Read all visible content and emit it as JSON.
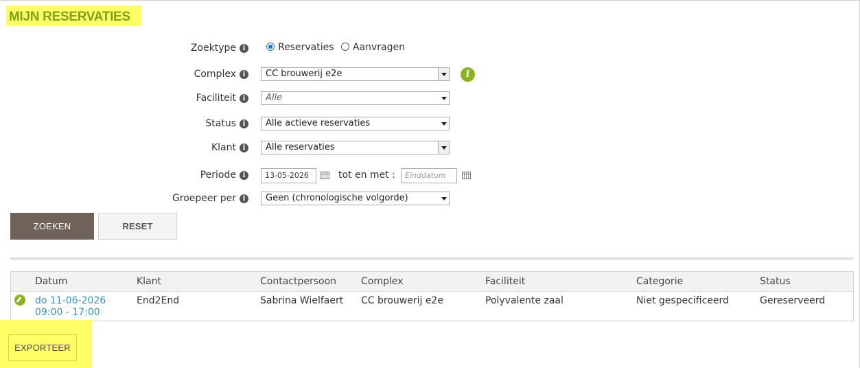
{
  "page": {
    "title": "MIJN RESERVATIES"
  },
  "form": {
    "zoektype": {
      "label": "Zoektype",
      "options": [
        "Reservaties",
        "Aanvragen"
      ],
      "selected": "Reservaties"
    },
    "complex": {
      "label": "Complex",
      "value": "CC brouwerij e2e"
    },
    "faciliteit": {
      "label": "Faciliteit",
      "value": "Alle"
    },
    "status": {
      "label": "Status",
      "value": "Alle actieve reservaties"
    },
    "klant": {
      "label": "Klant",
      "value": "Alle reservaties"
    },
    "periode": {
      "label": "Periode",
      "from": "13-05-2026",
      "to_label": "tot en met :",
      "to_placeholder": "Einddatum"
    },
    "groepeer": {
      "label": "Groepeer per",
      "value": "Geen (chronologische volgorde)"
    },
    "info_glyph": "i"
  },
  "buttons": {
    "search": "ZOEKEN",
    "reset": "RESET",
    "export": "EXPORTEER"
  },
  "table": {
    "columns": [
      "Datum",
      "Klant",
      "Contactpersoon",
      "Complex",
      "Faciliteit",
      "Categorie",
      "Status"
    ],
    "rows": [
      {
        "date": "do 11-06-2026",
        "time": "09:00 - 17:00",
        "klant": "End2End",
        "contact": "Sabrina Wielfaert",
        "complex": "CC brouwerij e2e",
        "faciliteit": "Polyvalente zaal",
        "categorie": "Niet gespecificeerd",
        "status": "Gereserveerd"
      }
    ]
  },
  "colors": {
    "accent": "#7fa21b",
    "highlight": "#ffff66",
    "primary_button": "#6f6359",
    "link": "#3a8fc3"
  }
}
